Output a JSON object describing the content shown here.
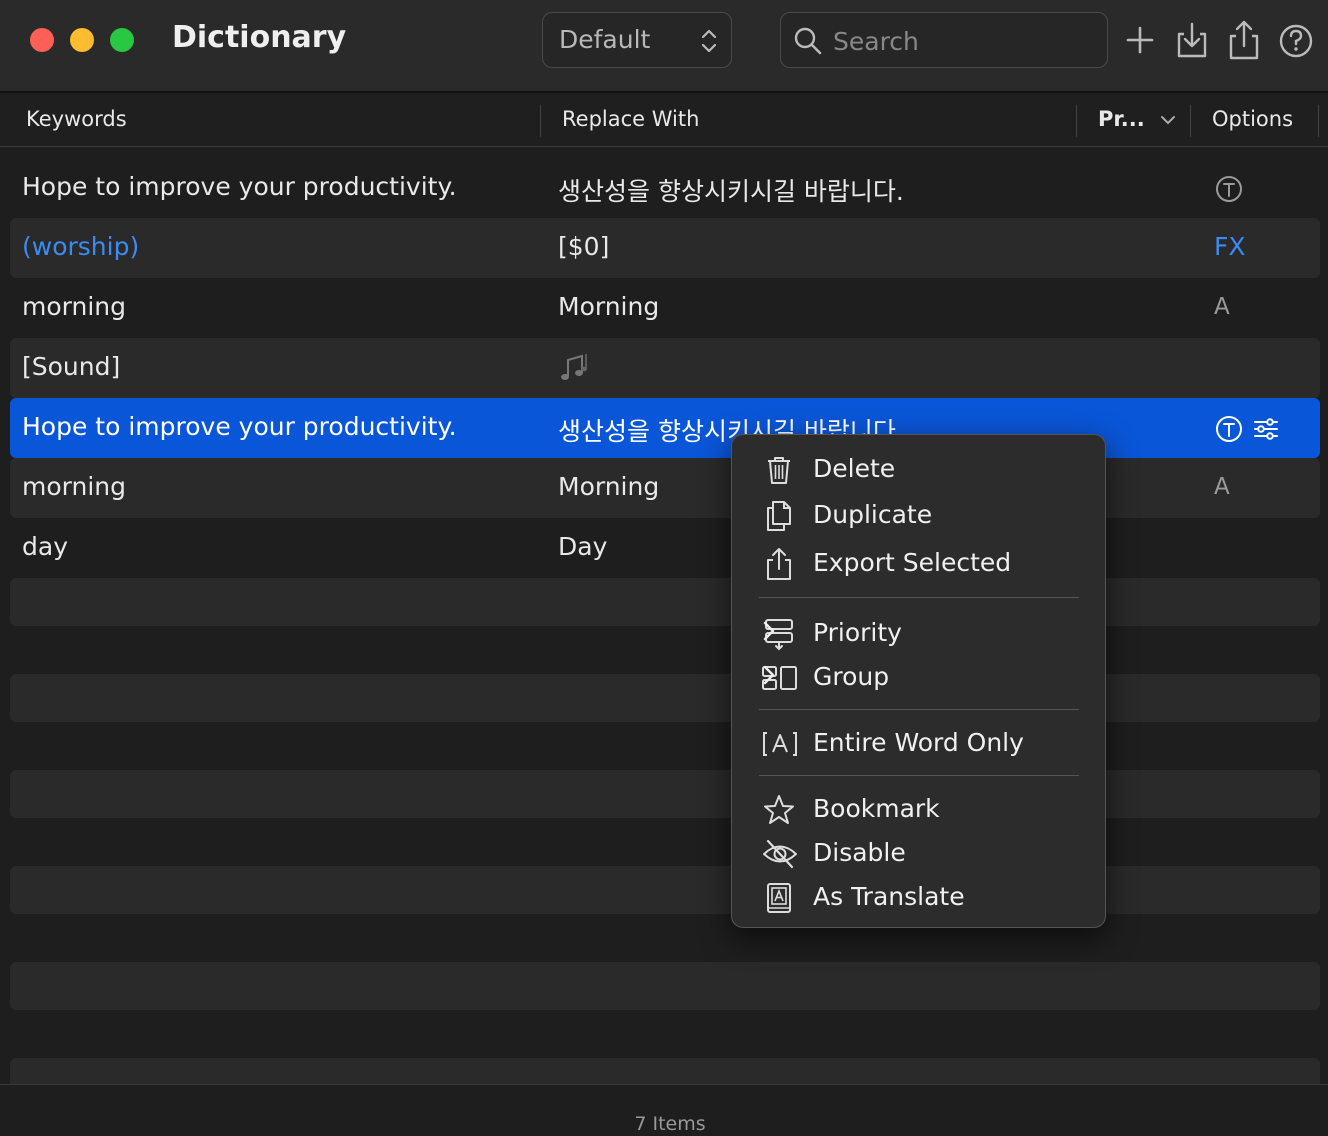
{
  "window": {
    "title": "Dictionary"
  },
  "toolbar": {
    "preset_value": "Default",
    "search_placeholder": "Search"
  },
  "columns": {
    "keywords": "Keywords",
    "replace_with": "Replace With",
    "priority": "Pr...",
    "options": "Options"
  },
  "rows": [
    {
      "keyword": "Hope to improve your productivity.",
      "replace": "생산성을 향상시키시길 바랍니다.",
      "option": "T-circle"
    },
    {
      "keyword": "(worship)",
      "replace": "[$0]",
      "option": "FX"
    },
    {
      "keyword": "morning",
      "replace": "Morning",
      "option": "A"
    },
    {
      "keyword": "[Sound]",
      "replace": "",
      "replace_icon": "music-notes",
      "option": ""
    },
    {
      "keyword": "Hope to improve your productivity.",
      "replace": "생산성을 향상시키시길 바랍니다.",
      "option": "T-circle",
      "selected": true
    },
    {
      "keyword": "morning",
      "replace": "Morning",
      "option": "A"
    },
    {
      "keyword": "day",
      "replace": "Day",
      "option": ""
    }
  ],
  "context_menu": {
    "delete": "Delete",
    "duplicate": "Duplicate",
    "export_selected": "Export Selected",
    "priority": "Priority",
    "group": "Group",
    "entire_word_only": "Entire Word Only",
    "bookmark": "Bookmark",
    "disable": "Disable",
    "as_translate": "As Translate"
  },
  "footer": {
    "item_count": "7  Items"
  },
  "colors": {
    "selection": "#0a56d8",
    "link_blue": "#3b8bf5",
    "close": "#ff5f57",
    "minimize": "#febc2e",
    "zoom": "#28c840"
  }
}
